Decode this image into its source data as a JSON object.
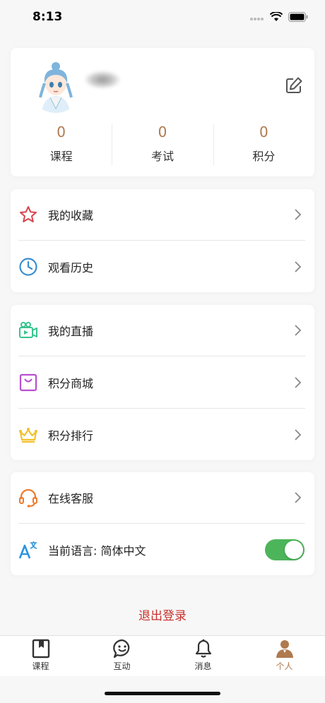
{
  "status_bar": {
    "time": "8:13"
  },
  "profile": {
    "stats": [
      {
        "value": "0",
        "label": "课程"
      },
      {
        "value": "0",
        "label": "考试"
      },
      {
        "value": "0",
        "label": "积分"
      }
    ]
  },
  "menu_group_1": [
    {
      "label": "我的收藏",
      "icon": "star-icon"
    },
    {
      "label": "观看历史",
      "icon": "clock-icon"
    }
  ],
  "menu_group_2": [
    {
      "label": "我的直播",
      "icon": "video-camera-icon"
    },
    {
      "label": "积分商城",
      "icon": "shopping-bag-icon"
    },
    {
      "label": "积分排行",
      "icon": "crown-icon"
    }
  ],
  "menu_group_3": [
    {
      "label": "在线客服",
      "icon": "headset-icon"
    },
    {
      "label": "当前语言: 简体中文",
      "icon": "language-icon",
      "toggle_on": true
    }
  ],
  "logout_label": "退出登录",
  "tabbar": [
    {
      "label": "课程",
      "icon": "book-icon",
      "active": false
    },
    {
      "label": "互动",
      "icon": "chat-bubble-icon",
      "active": false
    },
    {
      "label": "消息",
      "icon": "bell-icon",
      "active": false
    },
    {
      "label": "个人",
      "icon": "person-icon",
      "active": true
    }
  ],
  "colors": {
    "accent": "#b07a4f",
    "logout": "#c9302c",
    "toggle": "#4cb55a",
    "star": "#d9434c",
    "clock": "#3b8fd0",
    "video": "#37c48d",
    "bag": "#b84fd1",
    "crown": "#f2c12e",
    "headset": "#f07a2a",
    "language": "#2c94e0"
  }
}
